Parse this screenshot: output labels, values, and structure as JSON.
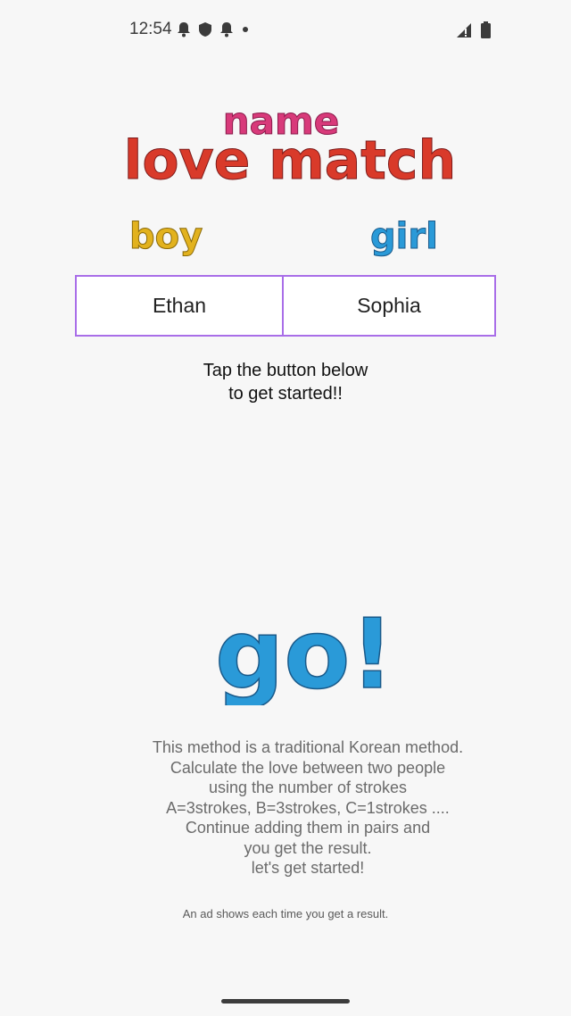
{
  "status_bar": {
    "time": "12:54",
    "icons": [
      "notification-bell-icon",
      "shield-icon",
      "notification-bell-icon",
      "dot-icon",
      "signal-icon",
      "battery-icon"
    ]
  },
  "logo": {
    "line1": "name",
    "line2": "love match"
  },
  "labels": {
    "boy": "boy",
    "girl": "girl"
  },
  "names": {
    "boy": "Ethan",
    "girl": "Sophia"
  },
  "instruction": {
    "line1": "Tap the button below",
    "line2": "to get started!!"
  },
  "go_button": {
    "text": "go!"
  },
  "description": [
    "This method is a traditional Korean method.",
    "Calculate the love between two people",
    "using the number of strokes",
    "A=3strokes, B=3strokes, C=1strokes ....",
    "Continue adding them in pairs and",
    "you get the result.",
    "let's get started!"
  ],
  "ad_note": "An ad shows each time you get a result.",
  "colors": {
    "accent_border": "#a96ee8",
    "logo_pink": "#d83a7a",
    "logo_red": "#d93a2a",
    "logo_yellow": "#e2b21e",
    "logo_purple": "#8a3a8a",
    "logo_green": "#2aa06a",
    "go_blue": "#2a9ad8",
    "go_purple": "#8a2a8a",
    "go_orange": "#e85a2a"
  }
}
